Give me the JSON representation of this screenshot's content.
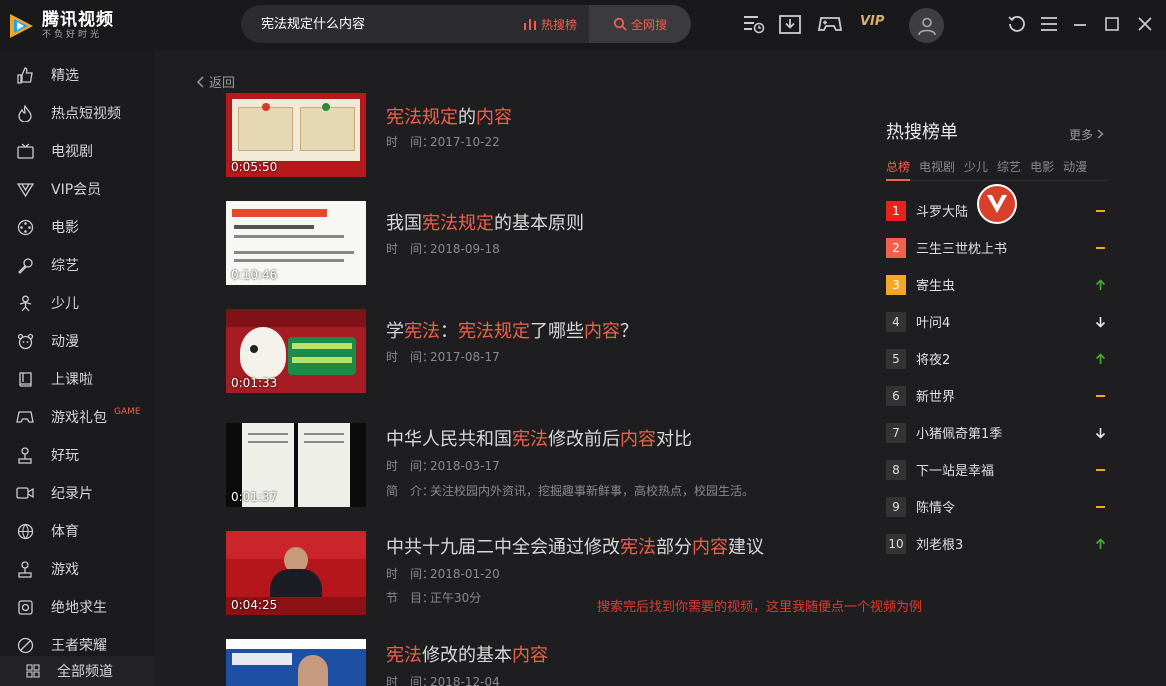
{
  "app": {
    "logo_title": "腾讯视频",
    "logo_slogan": "不负好时光",
    "accent": "#f0604a"
  },
  "search": {
    "query": "宪法规定什么内容",
    "hot_label": "热搜榜",
    "all_label": "全网搜"
  },
  "topbar": {
    "vip_label": "VIP"
  },
  "sidebar": {
    "items": [
      {
        "label": "精选",
        "icon": "thumbs-up-icon"
      },
      {
        "label": "热点短视频",
        "icon": "flame-icon"
      },
      {
        "label": "电视剧",
        "icon": "tv-icon"
      },
      {
        "label": "VIP会员",
        "icon": "vip-diamond-icon"
      },
      {
        "label": "电影",
        "icon": "film-reel-icon"
      },
      {
        "label": "综艺",
        "icon": "microphone-icon"
      },
      {
        "label": "少儿",
        "icon": "child-icon"
      },
      {
        "label": "动漫",
        "icon": "bear-icon"
      },
      {
        "label": "上课啦",
        "icon": "book-icon"
      },
      {
        "label": "游戏礼包",
        "icon": "gamepad-icon"
      },
      {
        "label": "好玩",
        "icon": "joystick-icon"
      },
      {
        "label": "纪录片",
        "icon": "camera-icon"
      },
      {
        "label": "体育",
        "icon": "ball-icon"
      },
      {
        "label": "游戏",
        "icon": "joystick-icon"
      },
      {
        "label": "绝地求生",
        "icon": "pubg-icon"
      },
      {
        "label": "王者荣耀",
        "icon": "compass-icon"
      }
    ],
    "game_badge": "GAME",
    "all_channels": "全部频道"
  },
  "main": {
    "back_label": "返回",
    "results": [
      {
        "title_parts": [
          [
            "宪法规定",
            true
          ],
          [
            "的",
            false
          ],
          [
            "内容",
            true
          ]
        ],
        "duration": "0:05:50",
        "meta": [
          [
            "时　间：",
            "2017-10-22"
          ]
        ]
      },
      {
        "title_parts": [
          [
            "我国",
            false
          ],
          [
            "宪法规定",
            true
          ],
          [
            "的基本原则",
            false
          ]
        ],
        "duration": "0:10:46",
        "meta": [
          [
            "时　间：",
            "2018-09-18"
          ]
        ]
      },
      {
        "title_parts": [
          [
            "学",
            false
          ],
          [
            "宪法",
            true
          ],
          [
            "：",
            false
          ],
          [
            "宪法规定",
            true
          ],
          [
            "了哪些",
            false
          ],
          [
            "内容",
            true
          ],
          [
            "？",
            false
          ]
        ],
        "duration": "0:01:33",
        "meta": [
          [
            "时　间：",
            "2017-08-17"
          ]
        ]
      },
      {
        "title_parts": [
          [
            "中华人民共和国",
            false
          ],
          [
            "宪法",
            true
          ],
          [
            "修改前后",
            false
          ],
          [
            "内容",
            true
          ],
          [
            "对比",
            false
          ]
        ],
        "duration": "0:01:37",
        "meta": [
          [
            "时　间：",
            "2018-03-17"
          ],
          [
            "简　介：",
            "关注校园内外资讯，挖掘趣事新鲜事，高校热点，校园生活。"
          ]
        ]
      },
      {
        "title_parts": [
          [
            "中共十九届二中全会通过修改",
            false
          ],
          [
            "宪法",
            true
          ],
          [
            "部分",
            false
          ],
          [
            "内容",
            true
          ],
          [
            "建议",
            false
          ]
        ],
        "duration": "0:04:25",
        "meta": [
          [
            "时　间：",
            "2018-01-20"
          ],
          [
            "节　目：",
            "正午30分"
          ]
        ]
      },
      {
        "title_parts": [
          [
            "宪法",
            true
          ],
          [
            "修改的基本",
            false
          ],
          [
            "内容",
            true
          ]
        ],
        "duration": "",
        "meta": [
          [
            "时　间：",
            "2018-12-04"
          ]
        ]
      }
    ],
    "tip": "搜索完后找到你需要的视频，这里我随便点一个视频为例"
  },
  "hot_panel": {
    "title": "热搜榜单",
    "more": "更多",
    "tabs": [
      "总榜",
      "电视剧",
      "少儿",
      "综艺",
      "电影",
      "动漫"
    ],
    "active_tab": 0,
    "ranks": [
      {
        "num": "1",
        "name": "斗罗大陆",
        "trend": "flat",
        "color": "#e8231e"
      },
      {
        "num": "2",
        "name": "三生三世枕上书",
        "trend": "flat",
        "color": "#f0604a"
      },
      {
        "num": "3",
        "name": "寄生虫",
        "trend": "up",
        "color": "#f5a623"
      },
      {
        "num": "4",
        "name": "叶问4",
        "trend": "down",
        "color": "#333"
      },
      {
        "num": "5",
        "name": "将夜2",
        "trend": "up",
        "color": "#333"
      },
      {
        "num": "6",
        "name": "新世界",
        "trend": "flat",
        "color": "#333"
      },
      {
        "num": "7",
        "name": "小猪佩奇第1季",
        "trend": "down",
        "color": "#333"
      },
      {
        "num": "8",
        "name": "下一站是幸福",
        "trend": "flat",
        "color": "#333"
      },
      {
        "num": "9",
        "name": "陈情令",
        "trend": "flat",
        "color": "#333"
      },
      {
        "num": "10",
        "name": "刘老根3",
        "trend": "up",
        "color": "#333"
      }
    ]
  }
}
